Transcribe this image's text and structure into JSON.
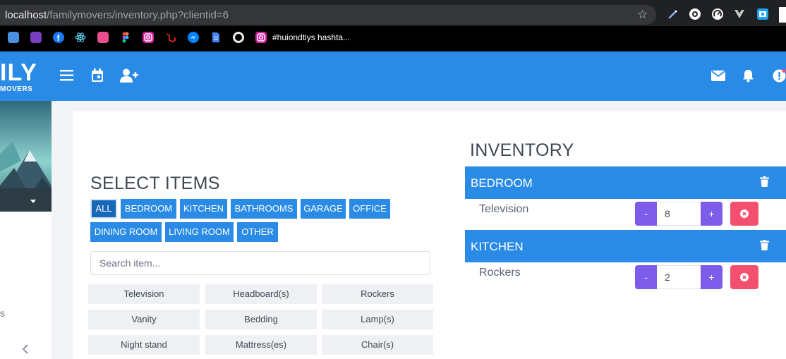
{
  "browser": {
    "url_host": "localhost",
    "url_path": "/familymovers/inventory.php?clientid=6",
    "bookmark_label": "#huiondtiys hashta..."
  },
  "logo": {
    "big": "ILY",
    "small": "MOVERS"
  },
  "select": {
    "title": "SELECT ITEMS",
    "categories": [
      "ALL",
      "BEDROOM",
      "KITCHEN",
      "BATHROOMS",
      "GARAGE",
      "OFFICE",
      "DINING ROOM",
      "LIVING ROOM",
      "OTHER"
    ],
    "active_category": "ALL",
    "search_placeholder": "Search item...",
    "items": [
      "Television",
      "Headboard(s)",
      "Rockers",
      "Vanity",
      "Bedding",
      "Lamp(s)",
      "Night stand",
      "Mattress(es)",
      "Chair(s)"
    ]
  },
  "inventory": {
    "title": "INVENTORY",
    "groups": [
      {
        "name": "BEDROOM",
        "items": [
          {
            "name": "Television",
            "qty": "8"
          }
        ]
      },
      {
        "name": "KITCHEN",
        "items": [
          {
            "name": "Rockers",
            "qty": "2"
          }
        ]
      }
    ],
    "minus_label": "-",
    "plus_label": "+"
  },
  "sidebar": {
    "partial_text": "s"
  },
  "colors": {
    "header": "#2a8be6",
    "category_button": "#2a8be6",
    "stepper": "#7c5ce8",
    "remove": "#f2506e"
  }
}
